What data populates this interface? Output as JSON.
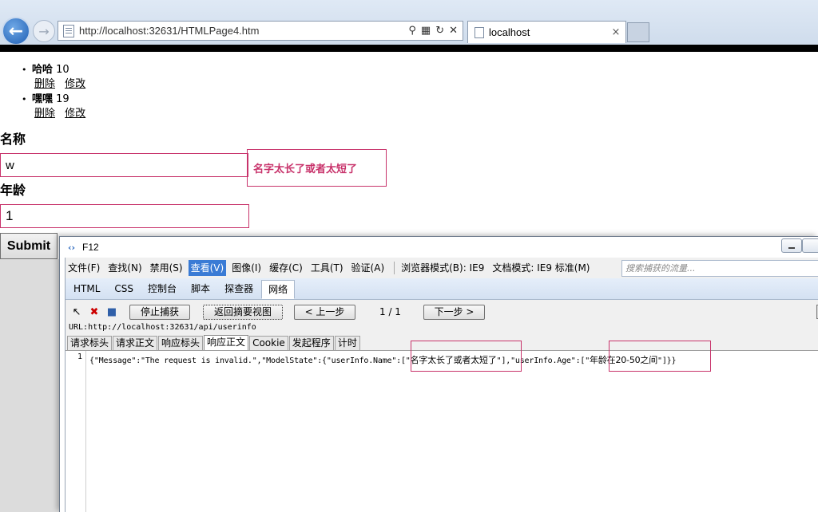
{
  "browser": {
    "url": "http://localhost:32631/HTMLPage4.htm",
    "tab_title": "localhost",
    "tab_close": "×"
  },
  "users": [
    {
      "name": "哈哈",
      "age": "10",
      "delete": "删除",
      "edit": "修改"
    },
    {
      "name": "嘿嘿",
      "age": "19",
      "delete": "删除",
      "edit": "修改"
    }
  ],
  "form": {
    "name_label": "名称",
    "name_value": "w",
    "name_error": "名字太长了或者太短了",
    "age_label": "年龄",
    "age_value": "1",
    "submit_label": "Submit"
  },
  "devtools": {
    "title": "F12",
    "menu": [
      {
        "label": "文件(F)",
        "active": false
      },
      {
        "label": "查找(N)",
        "active": false
      },
      {
        "label": "禁用(S)",
        "active": false
      },
      {
        "label": "查看(V)",
        "active": true
      },
      {
        "label": "图像(I)",
        "active": false
      },
      {
        "label": "缓存(C)",
        "active": false
      },
      {
        "label": "工具(T)",
        "active": false
      },
      {
        "label": "验证(A)",
        "active": false
      },
      {
        "label": "浏览器模式(B): IE9",
        "active": false
      },
      {
        "label": "文档模式: IE9 标准(M)",
        "active": false
      }
    ],
    "tabs": [
      {
        "label": "HTML",
        "active": false
      },
      {
        "label": "CSS",
        "active": false
      },
      {
        "label": "控制台",
        "active": false
      },
      {
        "label": "脚本",
        "active": false
      },
      {
        "label": "探查器",
        "active": false
      },
      {
        "label": "网络",
        "active": true
      }
    ],
    "search_placeholder": "搜索捕获的流量...",
    "toolbar": {
      "stop_capture": "停止捕获",
      "summary_view": "返回摘要视图",
      "prev": "< 上一步",
      "page": "1 / 1",
      "next": "下一步 >"
    },
    "request_url": "URL:http://localhost:32631/api/userinfo",
    "detail_tabs": [
      {
        "label": "请求标头",
        "active": false
      },
      {
        "label": "请求正文",
        "active": false
      },
      {
        "label": "响应标头",
        "active": false
      },
      {
        "label": "响应正文",
        "active": true
      },
      {
        "label": "Cookie",
        "active": false
      },
      {
        "label": "发起程序",
        "active": false
      },
      {
        "label": "计时",
        "active": false
      }
    ],
    "line_number": "1",
    "response": {
      "part1": "{\"Message\":\"The request is invalid.\",\"ModelState\":{\"userInfo.Name\":[\"",
      "name_msg": "名字太长了或者太短了",
      "part2": "\"],\"userInfo.Age\":[\"",
      "age_msg": "年龄在20-50之间",
      "part3": "\"]}}"
    }
  }
}
